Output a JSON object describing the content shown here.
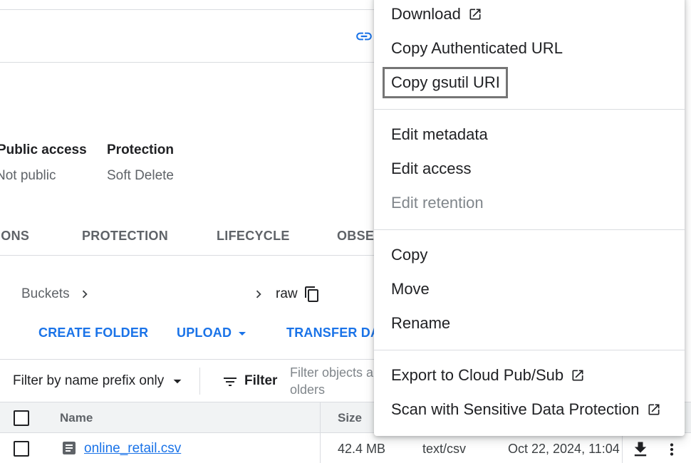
{
  "meta": {
    "public_access_label": "Public access",
    "public_access_value": "Not public",
    "protection_label": "Protection",
    "protection_value": "Soft Delete"
  },
  "tabs": [
    "IONS",
    "PROTECTION",
    "LIFECYCLE",
    "OBSERVABILITY"
  ],
  "breadcrumb": {
    "root": "Buckets",
    "current": "raw"
  },
  "actions": {
    "create_folder": "CREATE FOLDER",
    "upload": "UPLOAD",
    "transfer": "TRANSFER DATA"
  },
  "filter": {
    "prefix_label": "Filter by name prefix only",
    "filter_label": "Filter",
    "placeholder_line1": "Filter objects a",
    "placeholder_line2": "olders"
  },
  "table": {
    "headers": {
      "name": "Name",
      "size": "Size"
    },
    "rows": [
      {
        "name": "online_retail.csv",
        "size": "42.4 MB",
        "type": "text/csv",
        "created": "Oct 22, 2024, 11:04"
      }
    ]
  },
  "menu": {
    "download": "Download",
    "copy_auth_url": "Copy Authenticated URL",
    "copy_gsutil": "Copy gsutil URI",
    "edit_metadata": "Edit metadata",
    "edit_access": "Edit access",
    "edit_retention": "Edit retention",
    "copy": "Copy",
    "move": "Move",
    "rename": "Rename",
    "export_pubsub": "Export to Cloud Pub/Sub",
    "scan_sdp": "Scan with Sensitive Data Protection"
  },
  "icons": {
    "link": "link-icon",
    "external": "open-in-new-icon",
    "copy": "content-copy-icon",
    "chevron": "chevron-right-icon",
    "dropdown": "arrow-drop-down-icon",
    "filter": "filter-list-icon",
    "file": "file-icon",
    "download": "download-icon",
    "more": "more-vert-icon"
  },
  "colors": {
    "accent": "#1a73e8",
    "text": "#202124",
    "muted": "#5f6368"
  }
}
